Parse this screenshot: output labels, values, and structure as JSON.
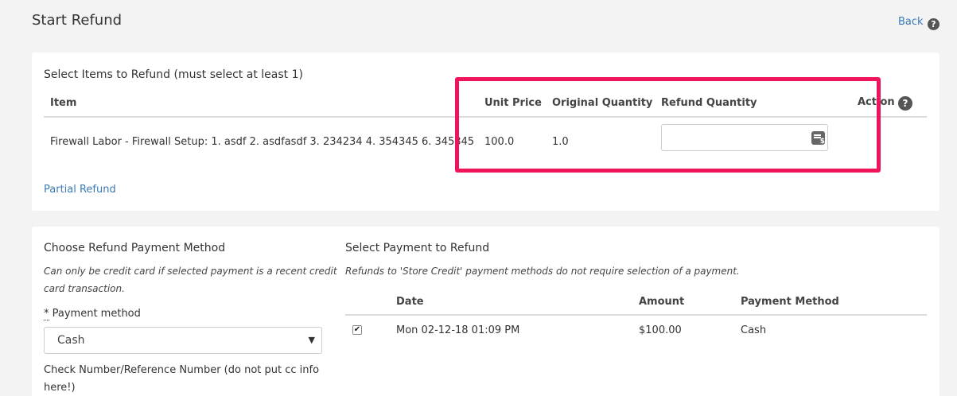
{
  "header": {
    "title": "Start Refund",
    "back_label": "Back",
    "help_glyph": "?"
  },
  "items_section": {
    "title": "Select Items to Refund (must select at least 1)",
    "columns": {
      "item": "Item",
      "unit_price": "Unit Price",
      "original_quantity": "Original Quantity",
      "refund_quantity": "Refund Quantity",
      "action": "Action"
    },
    "rows": [
      {
        "item": "Firewall Labor - Firewall Setup: 1. asdf 2. asdfasdf 3. 234234 4. 354345 6. 345345",
        "unit_price": "100.0",
        "original_quantity": "1.0",
        "refund_quantity": ""
      }
    ],
    "partial_refund_label": "Partial Refund",
    "highlight_color": "#f0145a"
  },
  "payment_method_section": {
    "title": "Choose Refund Payment Method",
    "note_line1": "Can only be credit card if selected payment is a recent credit",
    "note_line2": "card transaction.",
    "required_mark": "*",
    "payment_method_label": "Payment method",
    "payment_method_value": "Cash",
    "check_number_line1": "Check Number/Reference Number (do not put cc info",
    "check_number_line2": "here!)"
  },
  "payment_select_section": {
    "title": "Select Payment to Refund",
    "note": "Refunds to 'Store Credit' payment methods do not require selection of a payment.",
    "columns": {
      "date": "Date",
      "amount": "Amount",
      "payment_method": "Payment Method"
    },
    "rows": [
      {
        "checked": true,
        "date": "Mon 02-12-18 01:09 PM",
        "amount": "$100.00",
        "payment_method": "Cash"
      }
    ]
  },
  "icons": {
    "help": "help-icon",
    "calculator": "calculator-icon",
    "caret": "chevron-down-icon",
    "check": "checkmark-icon"
  },
  "colors": {
    "link": "#3a7ab8",
    "highlight": "#f0145a",
    "background": "#f3f3f3"
  }
}
